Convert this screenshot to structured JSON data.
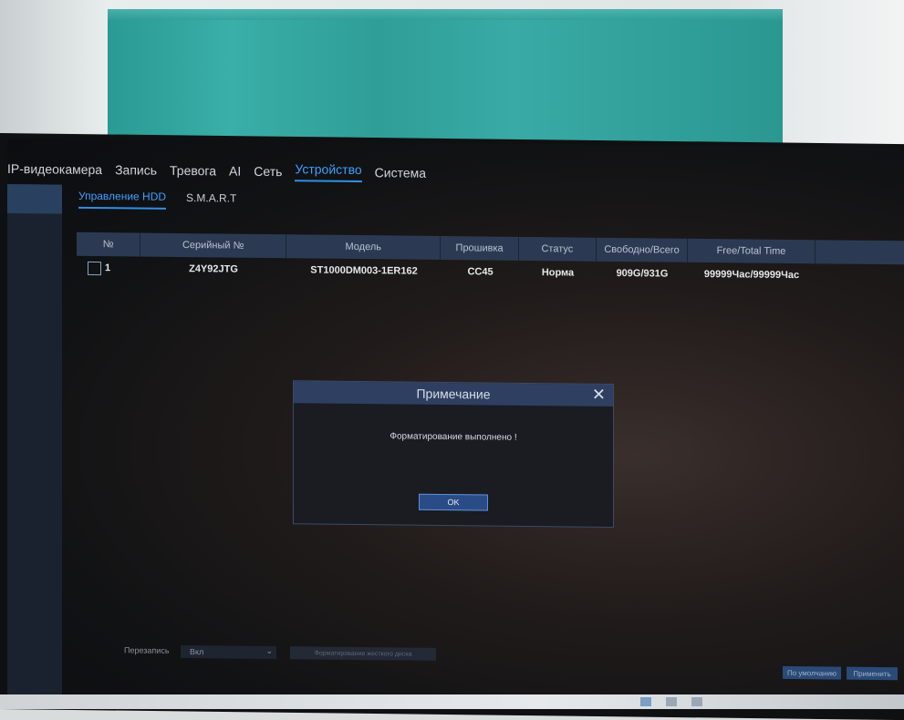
{
  "top_nav": [
    {
      "label": "IP-видеокамера",
      "active": false
    },
    {
      "label": "Запись",
      "active": false
    },
    {
      "label": "Тревога",
      "active": false
    },
    {
      "label": "AI",
      "active": false
    },
    {
      "label": "Сеть",
      "active": false
    },
    {
      "label": "Устройство",
      "active": true
    },
    {
      "label": "Система",
      "active": false
    }
  ],
  "sub_tabs": [
    {
      "label": "Управление HDD",
      "active": true
    },
    {
      "label": "S.M.A.R.T",
      "active": false
    }
  ],
  "table": {
    "headers": [
      "№",
      "Серийный №",
      "Модель",
      "Прошивка",
      "Статус",
      "Свободно/Всего",
      "Free/Total Time",
      ""
    ],
    "rows": [
      {
        "no": "1",
        "serial": "Z4Y92JTG",
        "model": "ST1000DM003-1ER162",
        "firmware": "CC45",
        "status": "Норма",
        "free_total": "909G/931G",
        "free_total_time": "99999Час/99999Час"
      }
    ]
  },
  "dialog": {
    "title": "Примечание",
    "message": "Форматирование выполнено !",
    "ok_label": "OK"
  },
  "bottom": {
    "overwrite_label": "Перезапись",
    "overwrite_value": "Вкл",
    "format_button": "Форматирование жесткого диска",
    "default_button": "По умолчанию",
    "apply_button": "Применить"
  }
}
